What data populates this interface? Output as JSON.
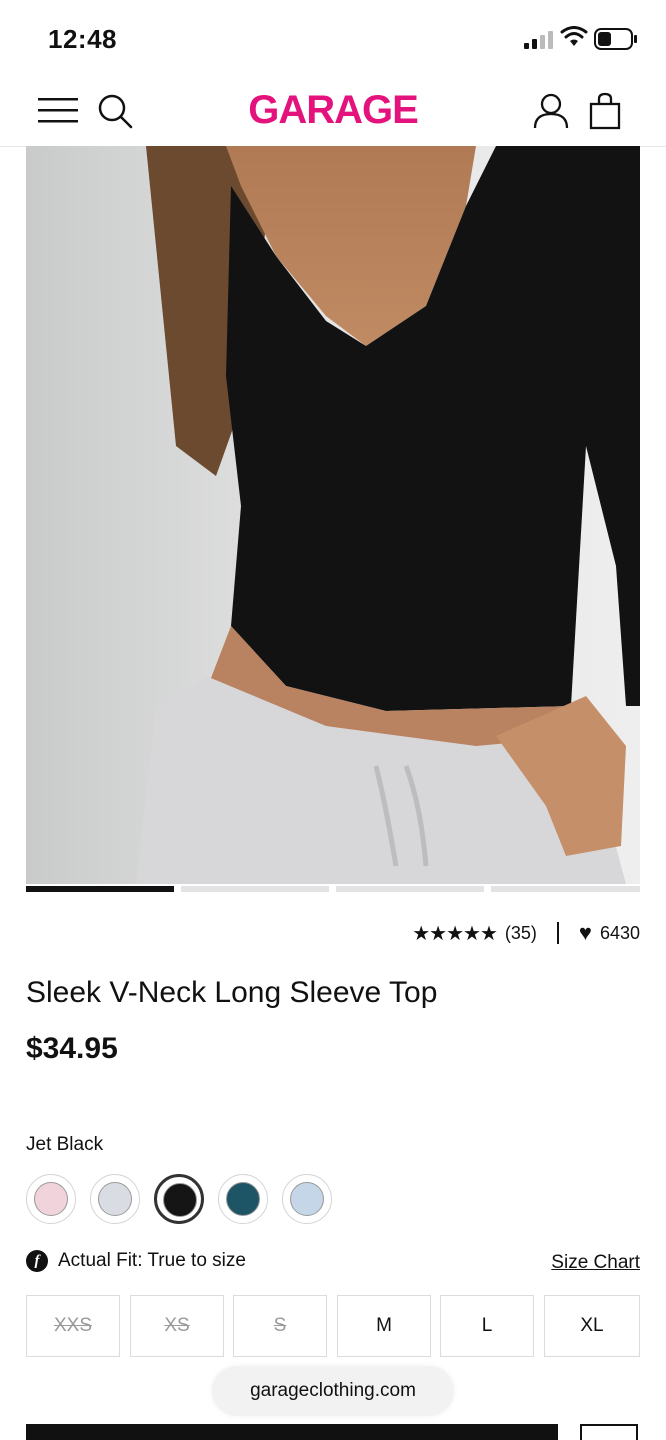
{
  "status_bar": {
    "time": "12:48"
  },
  "header": {
    "logo": "GARAGE"
  },
  "product": {
    "image_alt": "Model wearing black V-neck long sleeve top",
    "carousel": {
      "count": 4,
      "active": 0
    },
    "rating_count": "(35)",
    "rating_value": 5,
    "likes": "6430",
    "title": "Sleek V-Neck Long Sleeve Top",
    "price": "$34.95",
    "color_name": "Jet Black",
    "swatches": [
      {
        "name": "pink",
        "color": "#f1d3dc"
      },
      {
        "name": "light-grey",
        "color": "#d9dde3"
      },
      {
        "name": "jet-black",
        "color": "#151515",
        "selected": true
      },
      {
        "name": "teal",
        "color": "#1e5566"
      },
      {
        "name": "light-blue",
        "color": "#c5d6e8"
      }
    ],
    "fit_text": "Actual Fit: True to size",
    "size_chart": "Size Chart",
    "sizes": [
      {
        "label": "XXS",
        "available": false
      },
      {
        "label": "XS",
        "available": false
      },
      {
        "label": "S",
        "available": false
      },
      {
        "label": "M",
        "available": true
      },
      {
        "label": "L",
        "available": true
      },
      {
        "label": "XL",
        "available": true
      }
    ]
  },
  "browser": {
    "url": "garageclothing.com"
  },
  "colors": {
    "brand": "#e3127c"
  }
}
